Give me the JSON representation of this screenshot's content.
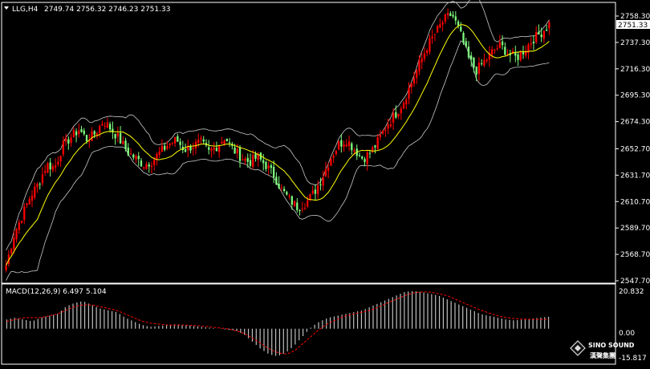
{
  "header": {
    "symbol_label": "LLG,H4",
    "ohlc_label": "2749.74 2756.32 2746.23 2751.33",
    "current_price_label": "2751.33"
  },
  "indicator": {
    "label": "MACD(12,26,9) 6.497 5.104",
    "max_label": "20.832",
    "zero_label": "0.00",
    "min_label": "-15.817",
    "max_value": 20.832,
    "min_value": -15.817
  },
  "logo": {
    "text_en": "SINO SOUND",
    "text_cn": "漢聲集團"
  },
  "colors": {
    "background": "#000000",
    "up_candle": "#ff0000",
    "down_candle": "#7fff7f",
    "ma_line": "#ffff00",
    "bands": "#c8c8c8",
    "macd_hist": "#c0c0c0",
    "macd_signal": "#ff0000"
  },
  "chart_data": {
    "type": "candlestick",
    "title": "",
    "xlabel": "",
    "ylabel": "",
    "grid": false,
    "ylim": [
      2547.7,
      2765.5
    ],
    "y_ticks": [
      {
        "value": 2758.3,
        "label": "2758.30"
      },
      {
        "value": 2737.3,
        "label": "2737.30"
      },
      {
        "value": 2716.3,
        "label": "2716.30"
      },
      {
        "value": 2695.3,
        "label": "2695.30"
      },
      {
        "value": 2674.3,
        "label": "2674.30"
      },
      {
        "value": 2652.7,
        "label": "2652.70"
      },
      {
        "value": 2631.7,
        "label": "2631.70"
      },
      {
        "value": 2610.7,
        "label": "2610.70"
      },
      {
        "value": 2589.7,
        "label": "2589.70"
      },
      {
        "value": 2568.7,
        "label": "2568.70"
      },
      {
        "value": 2547.7,
        "label": "2547.70"
      }
    ],
    "close_path": [
      2560,
      2585,
      2600,
      2615,
      2625,
      2640,
      2638,
      2655,
      2662,
      2668,
      2660,
      2665,
      2675,
      2668,
      2660,
      2650,
      2645,
      2640,
      2643,
      2650,
      2656,
      2660,
      2652,
      2655,
      2658,
      2650,
      2655,
      2662,
      2652,
      2646,
      2642,
      2646,
      2640,
      2632,
      2620,
      2612,
      2606,
      2610,
      2618,
      2630,
      2645,
      2656,
      2660,
      2652,
      2645,
      2650,
      2660,
      2672,
      2680,
      2690,
      2705,
      2720,
      2735,
      2745,
      2755,
      2760,
      2745,
      2725,
      2715,
      2722,
      2730,
      2735,
      2728,
      2725,
      2732,
      2740,
      2745,
      2752
    ],
    "macd_path": [
      5,
      6,
      5,
      4,
      6,
      7,
      8,
      12,
      14,
      15,
      13,
      11,
      10,
      9,
      6,
      4,
      2,
      1,
      1.5,
      2,
      2.5,
      2,
      1.5,
      1,
      0.5,
      0,
      -0.5,
      -1,
      -3,
      -7,
      -11,
      -14,
      -15,
      -13,
      -9,
      -4,
      1,
      4,
      6,
      7,
      8,
      9,
      10,
      12,
      14,
      16,
      18,
      20,
      20.5,
      20,
      19,
      18,
      16,
      14,
      12,
      10,
      8,
      7,
      6,
      5,
      4.5,
      5,
      5.5,
      6,
      6.5
    ],
    "signal_path": [
      4,
      5,
      6,
      6,
      6,
      7,
      8,
      10,
      12,
      13,
      13,
      12,
      11,
      10,
      8,
      6,
      4,
      3,
      2.5,
      2,
      2,
      2,
      1.8,
      1.5,
      1,
      0.5,
      0,
      -1,
      -2.5,
      -5,
      -8,
      -11,
      -13,
      -14,
      -12,
      -8,
      -4,
      0,
      3,
      5,
      7,
      8,
      9,
      10,
      12,
      14,
      16,
      18,
      19.5,
      20,
      20,
      19,
      18,
      16,
      14,
      12,
      10,
      8.5,
      7,
      6,
      5.5,
      5.2,
      5.1,
      5.1,
      5.1
    ]
  }
}
